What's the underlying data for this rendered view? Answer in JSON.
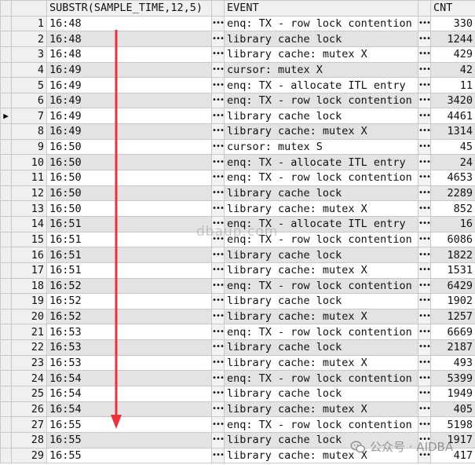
{
  "grid": {
    "headers": {
      "time": "SUBSTR(SAMPLE_TIME,12,5)",
      "event": "EVENT",
      "cnt": "CNT"
    },
    "dots": "•••",
    "current_row_marker": "▶",
    "current_row_index": 7,
    "rows": [
      {
        "n": "1",
        "time": "16:48",
        "event": "enq: TX - row lock contention",
        "cnt": "330"
      },
      {
        "n": "2",
        "time": "16:48",
        "event": "library cache lock",
        "cnt": "1244"
      },
      {
        "n": "3",
        "time": "16:48",
        "event": "library cache: mutex X",
        "cnt": "429"
      },
      {
        "n": "4",
        "time": "16:49",
        "event": "cursor: mutex X",
        "cnt": "42"
      },
      {
        "n": "5",
        "time": "16:49",
        "event": "enq: TX - allocate ITL entry",
        "cnt": "11"
      },
      {
        "n": "6",
        "time": "16:49",
        "event": "enq: TX - row lock contention",
        "cnt": "3420"
      },
      {
        "n": "7",
        "time": "16:49",
        "event": "library cache lock",
        "cnt": "4461"
      },
      {
        "n": "8",
        "time": "16:49",
        "event": "library cache: mutex X",
        "cnt": "1314"
      },
      {
        "n": "9",
        "time": "16:50",
        "event": "cursor: mutex S",
        "cnt": "45"
      },
      {
        "n": "10",
        "time": "16:50",
        "event": "enq: TX - allocate ITL entry",
        "cnt": "24"
      },
      {
        "n": "11",
        "time": "16:50",
        "event": "enq: TX - row lock contention",
        "cnt": "4653"
      },
      {
        "n": "12",
        "time": "16:50",
        "event": "library cache lock",
        "cnt": "2289"
      },
      {
        "n": "13",
        "time": "16:50",
        "event": "library cache: mutex X",
        "cnt": "852"
      },
      {
        "n": "14",
        "time": "16:51",
        "event": "enq: TX - allocate ITL entry",
        "cnt": "16"
      },
      {
        "n": "15",
        "time": "16:51",
        "event": "enq: TX - row lock contention",
        "cnt": "6086"
      },
      {
        "n": "16",
        "time": "16:51",
        "event": "library cache lock",
        "cnt": "1822"
      },
      {
        "n": "17",
        "time": "16:51",
        "event": "library cache: mutex X",
        "cnt": "1531"
      },
      {
        "n": "18",
        "time": "16:52",
        "event": "enq: TX - row lock contention",
        "cnt": "6429"
      },
      {
        "n": "19",
        "time": "16:52",
        "event": "library cache lock",
        "cnt": "1902"
      },
      {
        "n": "20",
        "time": "16:52",
        "event": "library cache: mutex X",
        "cnt": "1257"
      },
      {
        "n": "21",
        "time": "16:53",
        "event": "enq: TX - row lock contention",
        "cnt": "6669"
      },
      {
        "n": "22",
        "time": "16:53",
        "event": "library cache lock",
        "cnt": "2187"
      },
      {
        "n": "23",
        "time": "16:53",
        "event": "library cache: mutex X",
        "cnt": "493"
      },
      {
        "n": "24",
        "time": "16:54",
        "event": "enq: TX - row lock contention",
        "cnt": "5399"
      },
      {
        "n": "25",
        "time": "16:54",
        "event": "library cache lock",
        "cnt": "1949"
      },
      {
        "n": "26",
        "time": "16:54",
        "event": "library cache: mutex X",
        "cnt": "405"
      },
      {
        "n": "27",
        "time": "16:55",
        "event": "enq: TX - row lock contention",
        "cnt": "5198"
      },
      {
        "n": "28",
        "time": "16:55",
        "event": "library cache lock",
        "cnt": "1917"
      },
      {
        "n": "29",
        "time": "16:55",
        "event": "library cache: mutex X",
        "cnt": "417"
      }
    ]
  },
  "watermarks": {
    "center": "dbaup.com",
    "corner": "公众号 · AIDBA",
    "corner_icon": "wechat-icon"
  },
  "colors": {
    "arrow": "#e8333a",
    "alt_row": "#e3e3e3",
    "header_bg": "#f0f0f0"
  }
}
